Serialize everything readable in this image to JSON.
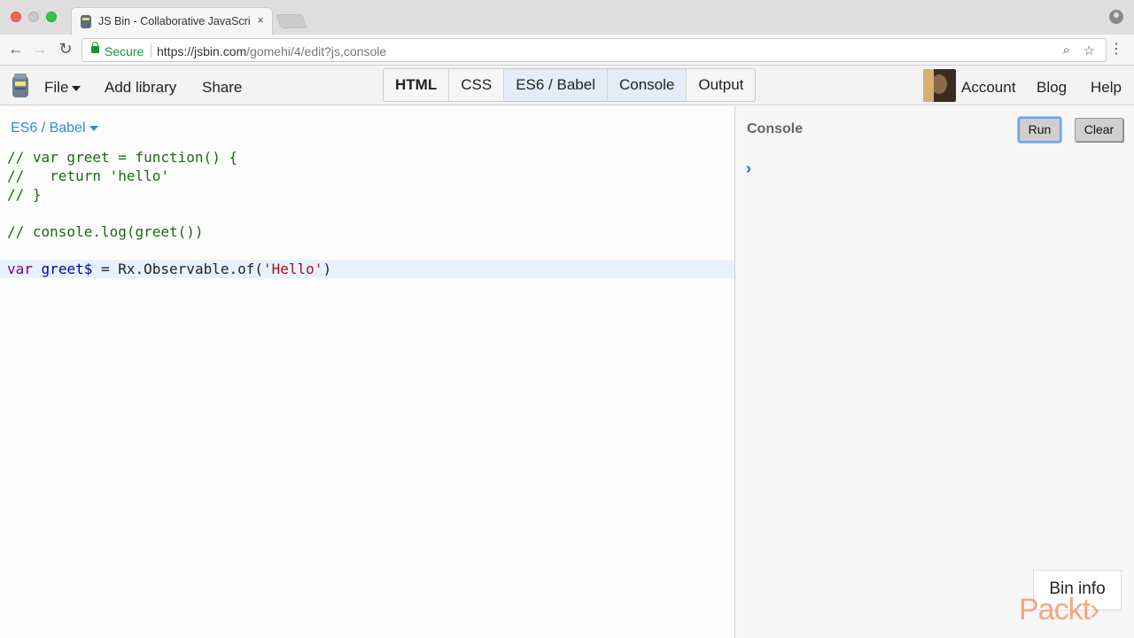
{
  "browser": {
    "tab_title": "JS Bin - Collaborative JavaScri",
    "tab_close": "×",
    "secure_label": "Secure",
    "url_main": "https://jsbin.com",
    "url_path": "/gomehi/4/edit?js,console"
  },
  "toolbar": {
    "file": "File",
    "add_library": "Add library",
    "share": "Share",
    "panels": [
      {
        "label": "HTML",
        "active": false
      },
      {
        "label": "CSS",
        "active": false
      },
      {
        "label": "ES6 / Babel",
        "active": true
      },
      {
        "label": "Console",
        "active": true
      },
      {
        "label": "Output",
        "active": false
      }
    ],
    "account": "Account",
    "blog": "Blog",
    "help": "Help"
  },
  "editor": {
    "language": "ES6 / Babel",
    "lines": [
      "// var greet = function() {",
      "//   return 'hello'",
      "// }",
      "",
      "// console.log(greet())",
      "",
      "var greet$ = Rx.Observable.of('Hello')"
    ],
    "active_line_parts": {
      "kw": "var",
      "var": "greet$",
      "mid": " = Rx.Observable.of(",
      "str": "'Hello'",
      "end": ")"
    }
  },
  "console": {
    "title": "Console",
    "run": "Run",
    "clear": "Clear",
    "prompt": "›"
  },
  "bin_info": "Bin info",
  "watermark": "Packt›",
  "colors": {
    "accent": "#2a8fd4",
    "comment": "#1a6a12",
    "keyword": "#770088",
    "string": "#aa1111"
  }
}
